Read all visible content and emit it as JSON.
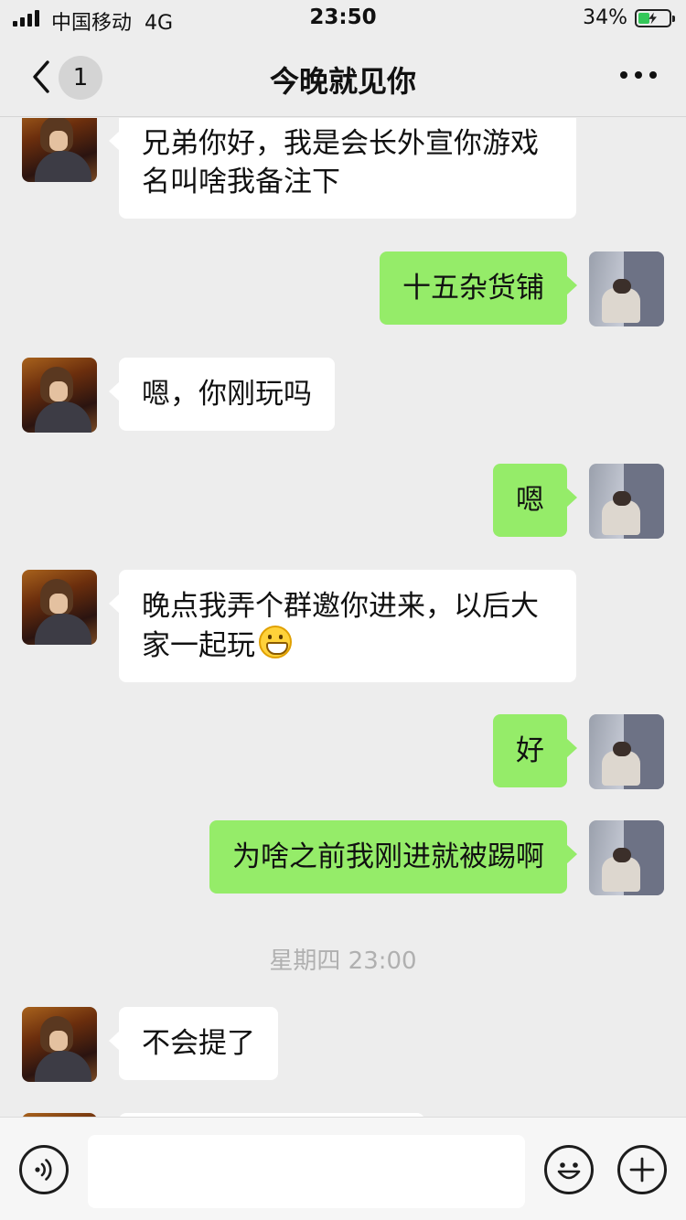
{
  "status_bar": {
    "carrier": "中国移动",
    "network": "4G",
    "time": "23:50",
    "battery_percent": "34%"
  },
  "nav": {
    "unread_count": "1",
    "title": "今晚就见你"
  },
  "messages": [
    {
      "side": "left",
      "text": "兄弟你好，我是会长外宣你游戏名叫啥我备注下"
    },
    {
      "side": "right",
      "text": "十五杂货铺"
    },
    {
      "side": "left",
      "text": "嗯，你刚玩吗"
    },
    {
      "side": "right",
      "text": "嗯"
    },
    {
      "side": "left",
      "text": "晚点我弄个群邀你进来，以后大家一起玩",
      "emoji": "grinning-emoji"
    },
    {
      "side": "right",
      "text": "好"
    },
    {
      "side": "right",
      "text": "为啥之前我刚进就被踢啊"
    },
    {
      "side": "left",
      "text": "不会提了"
    }
  ],
  "time_separator": "星期四 23:00",
  "input_bar": {
    "placeholder": "",
    "icons": [
      "voice-icon",
      "emoji-icon",
      "plus-icon"
    ]
  },
  "colors": {
    "background": "#ededed",
    "bubble_sent": "#95ec69",
    "bubble_received": "#ffffff",
    "battery": "#34c759"
  }
}
